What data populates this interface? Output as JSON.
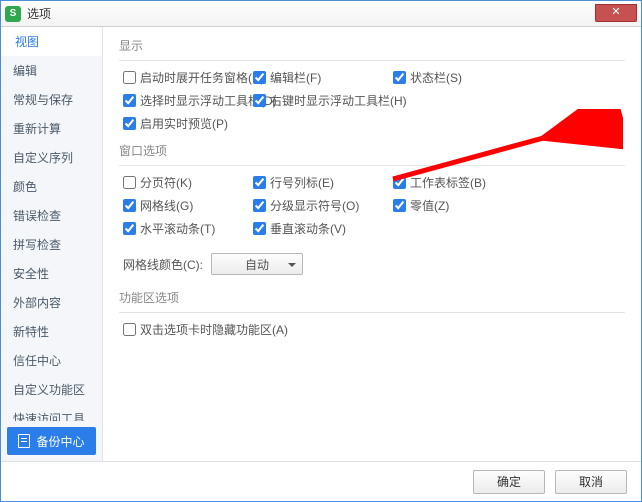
{
  "title": "选项",
  "close_glyph": "✕",
  "sidebar": {
    "items": [
      {
        "label": "视图",
        "active": true
      },
      {
        "label": "编辑"
      },
      {
        "label": "常规与保存"
      },
      {
        "label": "重新计算"
      },
      {
        "label": "自定义序列"
      },
      {
        "label": "颜色"
      },
      {
        "label": "错误检查"
      },
      {
        "label": "拼写检查"
      },
      {
        "label": "安全性"
      },
      {
        "label": "外部内容"
      },
      {
        "label": "新特性"
      },
      {
        "label": "信任中心"
      },
      {
        "label": "自定义功能区"
      },
      {
        "label": "快速访问工具栏"
      }
    ],
    "backup_label": "备份中心"
  },
  "sections": {
    "display": {
      "title": "显示",
      "opts": [
        {
          "key": "startup_taskpane",
          "label": "启动时展开任务窗格(U)",
          "checked": false
        },
        {
          "key": "edit_bar",
          "label": "编辑栏(F)",
          "checked": true
        },
        {
          "key": "status_bar",
          "label": "状态栏(S)",
          "checked": true
        },
        {
          "key": "sel_float_toolbar",
          "label": "选择时显示浮动工具栏(D)",
          "checked": true
        },
        {
          "key": "rclick_float_toolbar",
          "label": "右键时显示浮动工具栏(H)",
          "checked": true
        },
        {
          "key": "_blank1",
          "blank": true
        },
        {
          "key": "realtime_preview",
          "label": "启用实时预览(P)",
          "checked": true
        }
      ]
    },
    "window": {
      "title": "窗口选项",
      "opts": [
        {
          "key": "page_break",
          "label": "分页符(K)",
          "checked": false
        },
        {
          "key": "row_col_header",
          "label": "行号列标(E)",
          "checked": true
        },
        {
          "key": "sheet_tabs",
          "label": "工作表标签(B)",
          "checked": true
        },
        {
          "key": "gridlines",
          "label": "网格线(G)",
          "checked": true
        },
        {
          "key": "outline_symbols",
          "label": "分级显示符号(O)",
          "checked": true
        },
        {
          "key": "zero_values",
          "label": "零值(Z)",
          "checked": true
        },
        {
          "key": "h_scroll",
          "label": "水平滚动条(T)",
          "checked": true
        },
        {
          "key": "v_scroll",
          "label": "垂直滚动条(V)",
          "checked": true
        }
      ],
      "grid_color_label": "网格线颜色(C):",
      "grid_color_value": "自动"
    },
    "ribbon": {
      "title": "功能区选项",
      "opts": [
        {
          "key": "dblclick_hide_ribbon",
          "label": "双击选项卡时隐藏功能区(A)",
          "checked": false
        }
      ]
    }
  },
  "footer": {
    "ok": "确定",
    "cancel": "取消"
  }
}
